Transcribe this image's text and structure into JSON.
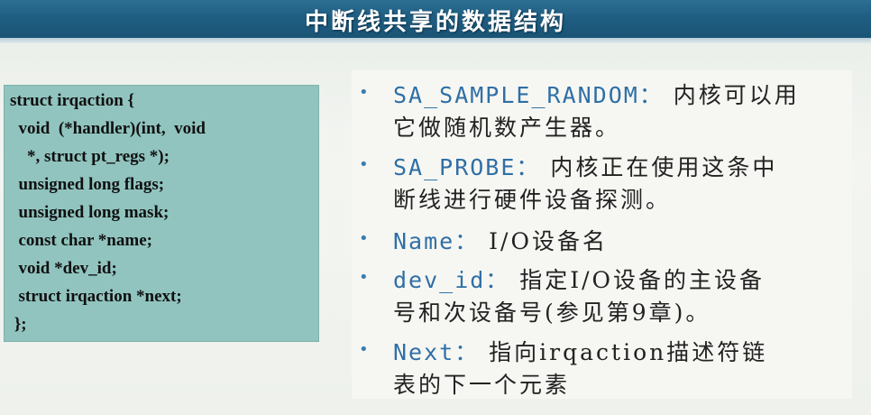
{
  "slide": {
    "title": "中断线共享的数据结构"
  },
  "code": {
    "lines": [
      "struct irqaction {",
      "  void  (*handler)(int,  void",
      "    *, struct pt_regs *);",
      "  unsigned long flags;",
      "  unsigned long mask;",
      "  const char *name;",
      "  void *dev_id;",
      "  struct irqaction *next;",
      " };"
    ]
  },
  "items": [
    {
      "key": "SA_SAMPLE_RANDOM：",
      "line1": " 内核可以用",
      "line2": "它做随机数产生器。"
    },
    {
      "key": "SA_PROBE：",
      "line1": " 内核正在使用这条中",
      "line2": "断线进行硬件设备探测。"
    },
    {
      "key": "Name：",
      "line1": " I/O设备名",
      "line2": ""
    },
    {
      "key": "dev_id：",
      "line1": " 指定I/O设备的主设备",
      "line2": "号和次设备号(参见第9章)。"
    },
    {
      "key": "Next：",
      "line1": " 指向irqaction描述符链",
      "line2": "表的下一个元素"
    }
  ],
  "colors": {
    "title_bg": "#1f5e82",
    "code_bg": "#91c4bf",
    "keyword": "#2f6fa6"
  },
  "icons": {
    "bullet": "bullet-dot-icon"
  }
}
